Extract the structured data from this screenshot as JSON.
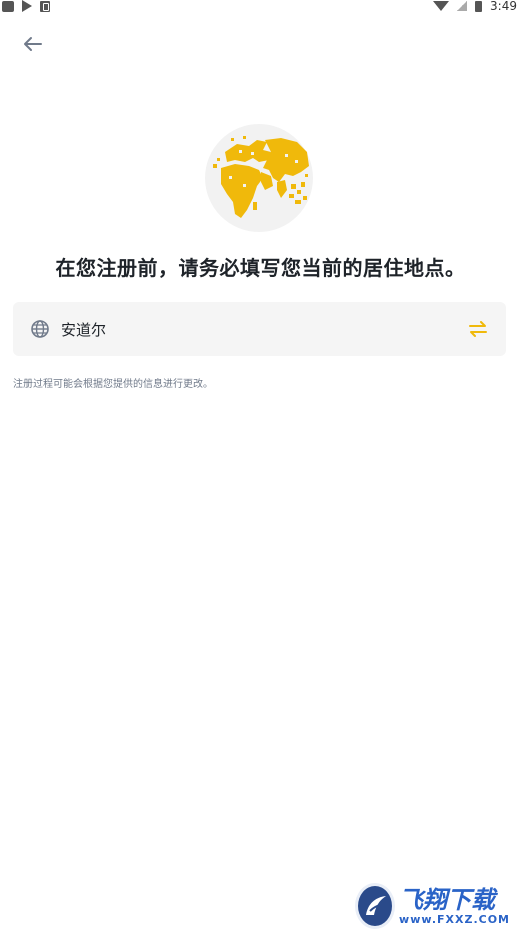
{
  "status_bar": {
    "time": "3:49"
  },
  "header": {
    "back_icon": "arrow-left-icon"
  },
  "illustration": {
    "icon": "world-map-globe-icon",
    "accent_color": "#f0b90b",
    "background_color": "#f2f2f2"
  },
  "title": "在您注册前，请务必填写您当前的居住地点。",
  "country": {
    "icon": "globe-icon",
    "value": "安道尔",
    "swap_icon": "swap-arrows-icon"
  },
  "hint": "注册过程可能会根据您提供的信息进行更改。",
  "watermark": {
    "title": "飞翔下载",
    "url": "www.FXXZ.COM"
  }
}
